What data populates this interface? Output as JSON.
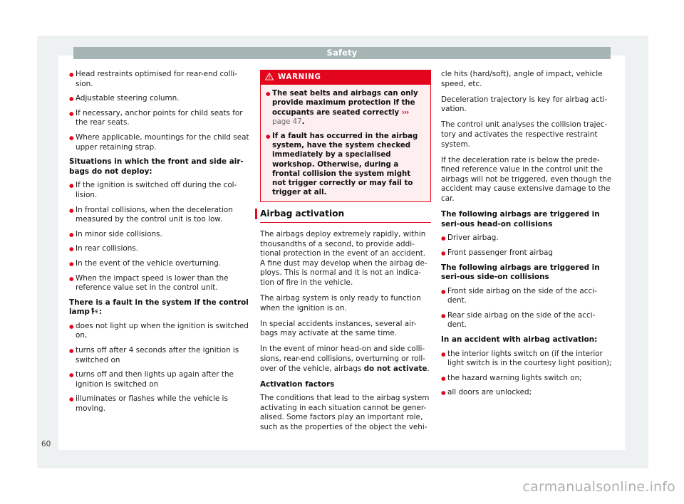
{
  "header": {
    "title": "Safety"
  },
  "page_number": "60",
  "watermark": "carmanualsonline.info",
  "column_1": {
    "top_bullets": [
      "Head restraints optimised for rear-end colli-sion.",
      "Adjustable steering column.",
      "If necessary, anchor points for child seats for the rear seats.",
      "Where applicable, mountings for the child seat upper retaining strap."
    ],
    "heading_no_deploy": "Situations in which the front and side air-bags do not deploy:",
    "no_deploy_bullets": [
      "If the ignition is switched off during the col-lision.",
      "In frontal collisions, when the deceleration measured by the control unit is too low.",
      "In minor side collisions.",
      "In rear collisions.",
      "In the event of the vehicle overturning.",
      "When the impact speed is lower than the reference value set in the control unit."
    ],
    "heading_fault_prefix": "There is a fault in the system if the control lamp",
    "heading_fault_suffix": ":",
    "fault_icon": "airbag-warning-lamp-icon",
    "fault_bullets": [
      "does not light up when the ignition is switched on,",
      "turns off after 4 seconds after the ignition is switched on",
      "turns off and then lights up again after the ignition is switched on",
      "illuminates or flashes while the vehicle is moving."
    ]
  },
  "warning_box": {
    "icon": "warning-triangle-icon",
    "label": "WARNING",
    "bullets": [
      {
        "text_before": "The seat belts and airbags can only provide maximum protection if the occupants are seated correctly ",
        "reference_chevron": "›››",
        "reference_text": " page 47",
        "text_after": "."
      },
      {
        "text_before": "If a fault has occurred in the airbag system, have the system checked immediately by a specialised workshop. Otherwise, during a frontal collision the system might not trigger correctly or may fail to trigger at all.",
        "reference_chevron": "",
        "reference_text": "",
        "text_after": ""
      }
    ]
  },
  "column_2": {
    "section_heading": "Airbag activation",
    "paragraphs": [
      "The airbags deploy extremely rapidly, within thousandths of a second, to provide addi-tional protection in the event of an accident. A fine dust may develop when the airbag de-ploys. This is normal and it is not an indica-tion of fire in the vehicle.",
      "The airbag system is only ready to function when the ignition is on.",
      "In special accidents instances, several air-bags may activate at the same time."
    ],
    "paragraph_with_bold": {
      "before": "In the event of minor head-on and side colli-sions, rear-end collisions, overturning or roll-over of the vehicle, airbags ",
      "bold": "do not activate",
      "after": "."
    },
    "heading_activation_factors": "Activation factors",
    "closing_paragraph": "The conditions that lead to the airbag system activating in each situation cannot be gener-alised. Some factors play an important role, such as the properties of the object the vehi-"
  },
  "column_3": {
    "paragraphs": [
      "cle hits (hard/soft), angle of impact, vehicle speed, etc.",
      "Deceleration trajectory is key for airbag acti-vation.",
      "The control unit analyses the collision trajec-tory and activates the respective restraint system.",
      "If the deceleration rate is below the prede-fined reference value in the control unit the airbags will not be triggered, even though the accident may cause extensive damage to the car."
    ],
    "heading_head_on": "The following airbags are triggered in seri-ous head-on collisions",
    "head_on_bullets": [
      "Driver airbag.",
      "Front passenger front airbag"
    ],
    "heading_side_on": "The following airbags are triggered in seri-ous side-on collisions",
    "side_on_bullets": [
      "Front side airbag on the side of the acci-dent.",
      "Rear side airbag on the side of the acci-dent."
    ],
    "heading_accident": "In an accident with airbag activation:",
    "accident_bullets": [
      "the interior lights switch on (if the interior light switch is in the courtesy light position);",
      "the hazard warning lights switch on;",
      "all doors are unlocked;"
    ]
  },
  "colors": {
    "brand_red": "#e3051b",
    "header_gray": "#a6b4b4",
    "page_bg": "#eef1f2"
  }
}
